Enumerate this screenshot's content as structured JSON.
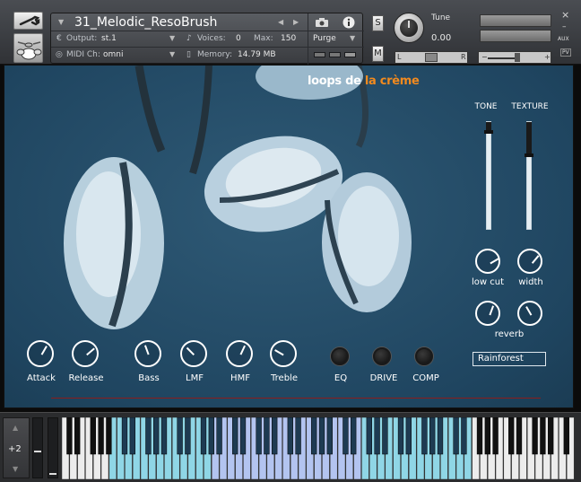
{
  "header": {
    "instrument_name": "31_Melodic_ResoBrush",
    "output_label": "Output:",
    "output_value": "st.1",
    "voices_label": "Voices:",
    "voices_value": "0",
    "max_label": "Max:",
    "max_value": "150",
    "purge_label": "Purge",
    "midi_label": "MIDI Ch:",
    "midi_value": "omni",
    "memory_label": "Memory:",
    "memory_value": "14.79 MB",
    "solo_label": "S",
    "mute_label": "M",
    "tune_label": "Tune",
    "tune_value": "0.00",
    "pan_left": "L",
    "pan_right": "R",
    "vol_minus": "−",
    "vol_plus": "+",
    "close_glyph": "×",
    "minimize_glyph": "–",
    "aux_label": "AUX",
    "pv_label": "PV"
  },
  "panel": {
    "logo_part1": "loops de",
    "logo_part2": "la crème",
    "tone_label": "TONE",
    "texture_label": "TEXTURE",
    "tone_level": 0.92,
    "texture_level": 0.7,
    "knobs": [
      {
        "label": "Attack"
      },
      {
        "label": "Release"
      },
      {
        "label": "Bass"
      },
      {
        "label": "LMF"
      },
      {
        "label": "HMF"
      },
      {
        "label": "Treble"
      }
    ],
    "fx_buttons": [
      {
        "label": "EQ"
      },
      {
        "label": "DRIVE"
      },
      {
        "label": "COMP"
      }
    ],
    "right_knobs_top": [
      {
        "label": "low cut"
      },
      {
        "label": "width"
      }
    ],
    "right_knobs_bottom_label": "reverb",
    "preset": "Rainforest"
  },
  "keyboard": {
    "octave_shift": "+2",
    "up_glyph": "▲",
    "down_glyph": "▼"
  },
  "colors": {
    "logo_accent": "#f28a1e",
    "key_light_blue": "#8fd6e6",
    "key_periwinkle": "#b3c4f0",
    "line_red": "#8a1d1d"
  }
}
